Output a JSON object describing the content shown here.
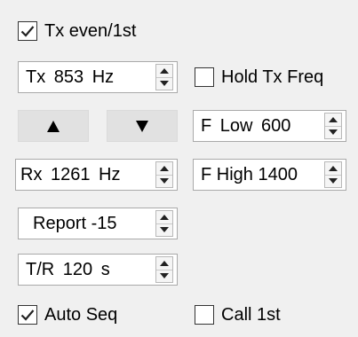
{
  "tx_even": {
    "label": "Tx even/1st",
    "checked": true
  },
  "tx_freq": {
    "value": "Tx  853  Hz"
  },
  "hold_tx_freq": {
    "label": "Hold Tx Freq",
    "checked": false
  },
  "arrows": {
    "up_icon": "triangle-up-icon",
    "down_icon": "triangle-down-icon"
  },
  "f_low": {
    "value": "F Low   600"
  },
  "rx_freq": {
    "value": "Rx  1261  Hz"
  },
  "f_high": {
    "value": "F High 1400"
  },
  "report": {
    "value": "Report -15"
  },
  "tr_period": {
    "value": "T/R  120  s"
  },
  "auto_seq": {
    "label": "Auto Seq",
    "checked": true
  },
  "call_1st": {
    "label": "Call 1st",
    "checked": false
  },
  "colors": {
    "panel_bg": "#f0f0f0",
    "button_bg": "#e1e1e1",
    "field_border": "#a9a9a9"
  }
}
